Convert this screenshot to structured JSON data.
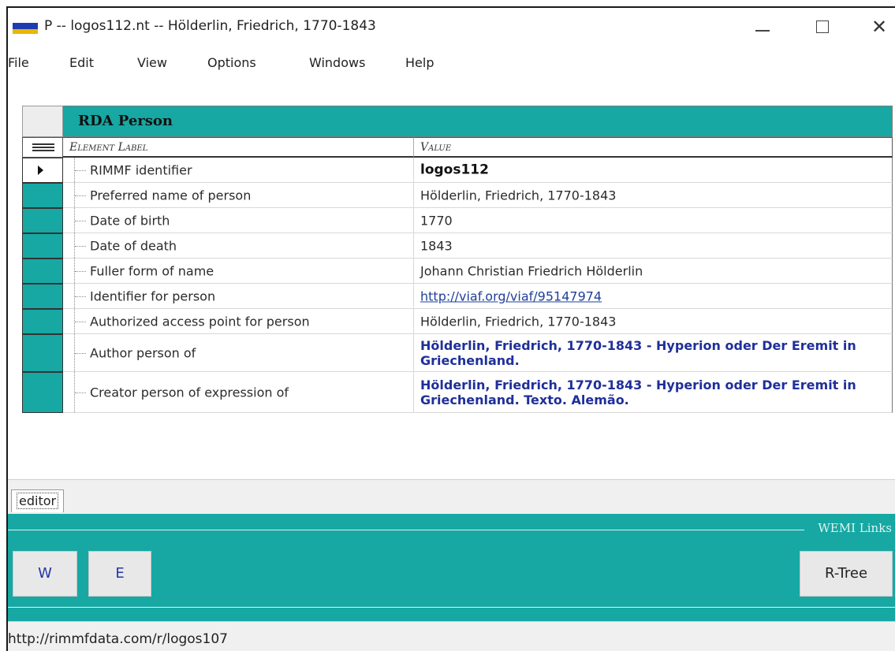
{
  "window": {
    "title": "P  --  logos112.nt  --  Hölderlin, Friedrich, 1770-1843",
    "minimize_glyph": "—",
    "maximize_glyph": "☐",
    "close_glyph": "✕"
  },
  "menu": {
    "items": [
      "File",
      "Edit",
      "View",
      "Options",
      "Windows",
      "Help"
    ]
  },
  "grid": {
    "title": "RDA Person",
    "columns": {
      "label": "Element Label",
      "value": "Value"
    },
    "rows": [
      {
        "label": "RIMMF identifier",
        "value": "logos112",
        "style": "bold",
        "selected": true
      },
      {
        "label": "Preferred name of person",
        "value": "Hölderlin, Friedrich, 1770-1843",
        "style": "normal"
      },
      {
        "label": "Date of birth",
        "value": "1770",
        "style": "normal"
      },
      {
        "label": "Date of death",
        "value": "1843",
        "style": "normal"
      },
      {
        "label": "Fuller form of name",
        "value": "Johann Christian Friedrich Hölderlin",
        "style": "normal"
      },
      {
        "label": "Identifier for person",
        "value": "http://viaf.org/viaf/95147974",
        "style": "link"
      },
      {
        "label": "Authorized access point for person",
        "value": "Hölderlin, Friedrich, 1770-1843",
        "style": "normal"
      },
      {
        "label": "Author person of",
        "value": "Hölderlin, Friedrich, 1770-1843 - Hyperion oder Der Eremit in Griechenland.",
        "style": "relation"
      },
      {
        "label": "Creator person of expression of",
        "value": "Hölderlin, Friedrich, 1770-1843 - Hyperion oder Der Eremit in Griechenland. Texto. Alemão.",
        "style": "relation"
      }
    ]
  },
  "tabs": {
    "editor": "editor"
  },
  "wemi": {
    "label": "WEMI Links",
    "w_button": "W",
    "e_button": "E",
    "rtree_button": "R-Tree"
  },
  "status": {
    "url": "http://rimmfdata.com/r/logos107"
  },
  "colors": {
    "accent_teal": "#17a8a3",
    "link_blue": "#1f3f9a",
    "relation_blue": "#1f2f9a"
  },
  "icons": {
    "app": "rimmf-app-icon",
    "row_indicator": "triangle-right-icon",
    "column_handle": "grid-lines-icon"
  }
}
